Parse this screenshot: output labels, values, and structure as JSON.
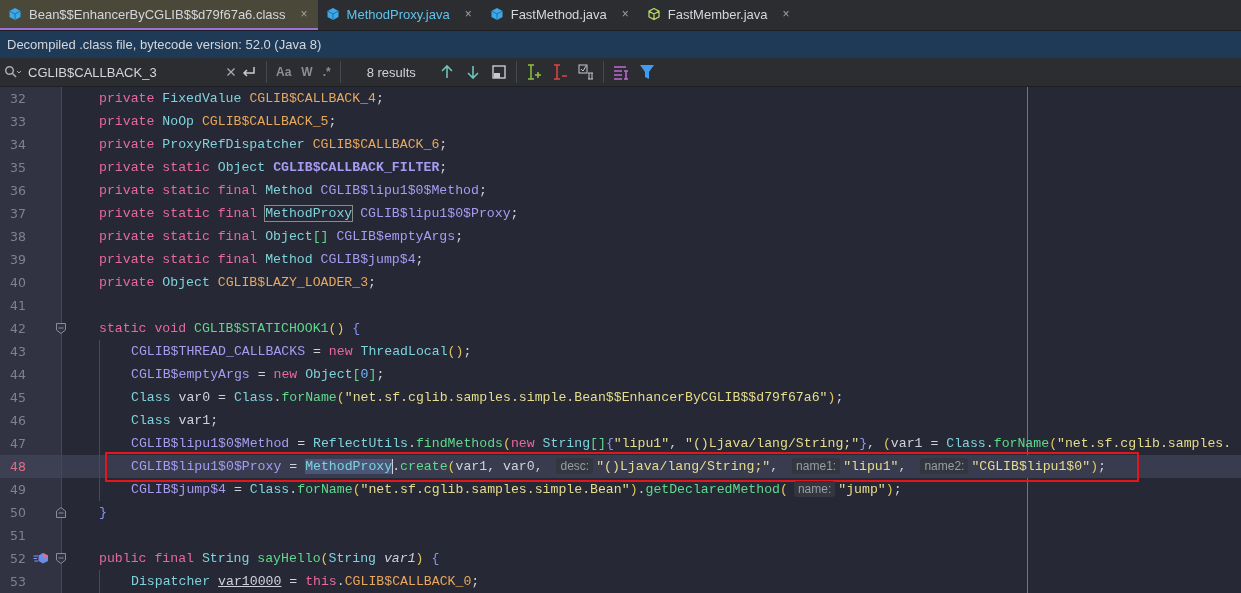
{
  "tabs": [
    {
      "label": "Bean$$EnhancerByCGLIB$$d79f67a6.class",
      "close": "×",
      "kind": "class",
      "selected": true,
      "modified": false
    },
    {
      "label": "MethodProxy.java",
      "close": "×",
      "kind": "java",
      "selected": false,
      "modified": true
    },
    {
      "label": "FastMethod.java",
      "close": "×",
      "kind": "java",
      "selected": false,
      "modified": false
    },
    {
      "label": "FastMember.java",
      "close": "×",
      "kind": "member",
      "selected": false,
      "modified": false
    }
  ],
  "info_bar": "Decompiled .class file, bytecode version: 52.0 (Java 8)",
  "search": {
    "value": "CGLIB$CALLBACK_3",
    "options": [
      "Aa",
      "W",
      ".*"
    ],
    "results": "8 results"
  },
  "lines": [
    {
      "number": "32",
      "tokens": [
        {
          "t": "private ",
          "kind": "kw"
        },
        {
          "t": "FixedValue ",
          "kind": "type"
        },
        {
          "t": "CGLIB$CALLBACK_4",
          "kind": "field"
        },
        {
          "t": ";",
          "kind": "plain"
        }
      ]
    },
    {
      "number": "33",
      "tokens": [
        {
          "t": "private ",
          "kind": "kw"
        },
        {
          "t": "NoOp ",
          "kind": "type"
        },
        {
          "t": "CGLIB$CALLBACK_5",
          "kind": "field"
        },
        {
          "t": ";",
          "kind": "plain"
        }
      ]
    },
    {
      "number": "34",
      "tokens": [
        {
          "t": "private ",
          "kind": "kw"
        },
        {
          "t": "ProxyRefDispatcher ",
          "kind": "type"
        },
        {
          "t": "CGLIB$CALLBACK_6",
          "kind": "field"
        },
        {
          "t": ";",
          "kind": "plain"
        }
      ]
    },
    {
      "number": "35",
      "tokens": [
        {
          "t": "private static ",
          "kind": "kw"
        },
        {
          "t": "Object ",
          "kind": "type"
        },
        {
          "t": "CGLIB$CALLBACK_FILTER",
          "kind": "sfieldb"
        },
        {
          "t": ";",
          "kind": "plain"
        }
      ]
    },
    {
      "number": "36",
      "tokens": [
        {
          "t": "private static final ",
          "kind": "kw"
        },
        {
          "t": "Method ",
          "kind": "type"
        },
        {
          "t": "CGLIB$lipu1$0$Method",
          "kind": "sfield"
        },
        {
          "t": ";",
          "kind": "plain"
        }
      ]
    },
    {
      "number": "37",
      "tokens": [
        {
          "t": "private static final ",
          "kind": "kw"
        },
        {
          "t": "MethodProxy",
          "kind": "type",
          "outlined": true
        },
        {
          "t": " CGLIB$lipu1$0$Proxy",
          "kind": "sfield"
        },
        {
          "t": ";",
          "kind": "plain"
        }
      ]
    },
    {
      "number": "38",
      "tokens": [
        {
          "t": "private static final ",
          "kind": "kw"
        },
        {
          "t": "Object",
          "kind": "type"
        },
        {
          "t": "[]",
          "kind": "bracket"
        },
        {
          "t": " CGLIB$emptyArgs",
          "kind": "sfield"
        },
        {
          "t": ";",
          "kind": "plain"
        }
      ]
    },
    {
      "number": "39",
      "tokens": [
        {
          "t": "private static final ",
          "kind": "kw"
        },
        {
          "t": "Method ",
          "kind": "type"
        },
        {
          "t": "CGLIB$jump$4",
          "kind": "sfield"
        },
        {
          "t": ";",
          "kind": "plain"
        }
      ]
    },
    {
      "number": "40",
      "tokens": [
        {
          "t": "private ",
          "kind": "kw"
        },
        {
          "t": "Object ",
          "kind": "type"
        },
        {
          "t": "CGLIB$LAZY_LOADER_3",
          "kind": "field"
        },
        {
          "t": ";",
          "kind": "plain"
        }
      ]
    },
    {
      "number": "41"
    },
    {
      "number": "42",
      "fold_start": true,
      "tokens": [
        {
          "t": "static void ",
          "kind": "kw"
        },
        {
          "t": "CGLIB$STATICHOOK1",
          "kind": "method"
        },
        {
          "t": "()",
          "kind": "paren"
        },
        {
          "t": " {",
          "kind": "brace"
        }
      ],
      "children": [
        {
          "number": "43",
          "tokens": [
            {
              "t": "CGLIB$THREAD_CALLBACKS",
              "kind": "sfield"
            },
            {
              "t": " = ",
              "kind": "plain"
            },
            {
              "t": "new ",
              "kind": "kw"
            },
            {
              "t": "ThreadLocal",
              "kind": "type"
            },
            {
              "t": "()",
              "kind": "paren"
            },
            {
              "t": ";",
              "kind": "plain"
            }
          ]
        },
        {
          "number": "44",
          "tokens": [
            {
              "t": "CGLIB$emptyArgs",
              "kind": "sfield"
            },
            {
              "t": " = ",
              "kind": "plain"
            },
            {
              "t": "new ",
              "kind": "kw"
            },
            {
              "t": "Object",
              "kind": "type"
            },
            {
              "t": "[",
              "kind": "bracket"
            },
            {
              "t": "0",
              "kind": "num"
            },
            {
              "t": "]",
              "kind": "bracket"
            },
            {
              "t": ";",
              "kind": "plain"
            }
          ]
        },
        {
          "number": "45",
          "tokens": [
            {
              "t": "Class ",
              "kind": "type"
            },
            {
              "t": "var0 = ",
              "kind": "plain"
            },
            {
              "t": "Class",
              "kind": "type"
            },
            {
              "t": ".",
              "kind": "plain"
            },
            {
              "t": "forName",
              "kind": "method"
            },
            {
              "t": "(",
              "kind": "paren"
            },
            {
              "t": "\"net.sf.cglib.samples.simple.Bean$$EnhancerByCGLIB$$d79f67a6\"",
              "kind": "str"
            },
            {
              "t": ")",
              "kind": "paren"
            },
            {
              "t": ";",
              "kind": "plain"
            }
          ]
        },
        {
          "number": "46",
          "tokens": [
            {
              "t": "Class ",
              "kind": "type"
            },
            {
              "t": "var1;",
              "kind": "plain"
            }
          ]
        },
        {
          "number": "47",
          "tokens": [
            {
              "t": "CGLIB$lipu1$0$Method",
              "kind": "sfield"
            },
            {
              "t": " = ",
              "kind": "plain"
            },
            {
              "t": "ReflectUtils",
              "kind": "type"
            },
            {
              "t": ".",
              "kind": "plain"
            },
            {
              "t": "findMethods",
              "kind": "method"
            },
            {
              "t": "(",
              "kind": "paren"
            },
            {
              "t": "new ",
              "kind": "kw"
            },
            {
              "t": "String",
              "kind": "type"
            },
            {
              "t": "[]",
              "kind": "bracket"
            },
            {
              "t": "{",
              "kind": "brace"
            },
            {
              "t": "\"lipu1\"",
              "kind": "str"
            },
            {
              "t": ", ",
              "kind": "plain"
            },
            {
              "t": "\"()Ljava/lang/String;\"",
              "kind": "str"
            },
            {
              "t": "}",
              "kind": "brace"
            },
            {
              "t": ", ",
              "kind": "plain"
            },
            {
              "t": "(",
              "kind": "paren"
            },
            {
              "t": "var1 = ",
              "kind": "plain"
            },
            {
              "t": "Class",
              "kind": "type"
            },
            {
              "t": ".",
              "kind": "plain"
            },
            {
              "t": "forName",
              "kind": "method"
            },
            {
              "t": "(",
              "kind": "paren"
            },
            {
              "t": "\"net.sf.cglib.samples.",
              "kind": "str"
            }
          ]
        },
        {
          "number": "48",
          "current": true,
          "annotated": true,
          "tokens": [
            {
              "t": "CGLIB$lipu1$0$Proxy",
              "kind": "sfield"
            },
            {
              "t": " = ",
              "kind": "plain"
            },
            {
              "t": "MethodProxy",
              "kind": "type",
              "text_selected": true
            },
            {
              "t": ".",
              "kind": "plain"
            },
            {
              "t": "create",
              "kind": "method"
            },
            {
              "t": "(",
              "kind": "paren"
            },
            {
              "t": "var1, var0, ",
              "kind": "plain"
            },
            {
              "t": "desc:",
              "kind": "hint"
            },
            {
              "t": "\"()Ljava/lang/String;\"",
              "kind": "str"
            },
            {
              "t": ", ",
              "kind": "plain"
            },
            {
              "t": "name1:",
              "kind": "hint"
            },
            {
              "t": "\"lipu1\"",
              "kind": "str"
            },
            {
              "t": ", ",
              "kind": "plain"
            },
            {
              "t": "name2:",
              "kind": "hint"
            },
            {
              "t": "\"CGLIB$lipu1$0\"",
              "kind": "str"
            },
            {
              "t": ")",
              "kind": "paren"
            },
            {
              "t": ";",
              "kind": "plain"
            }
          ]
        },
        {
          "number": "49",
          "tokens": [
            {
              "t": "CGLIB$jump$4",
              "kind": "sfield"
            },
            {
              "t": " = ",
              "kind": "plain"
            },
            {
              "t": "Class",
              "kind": "type"
            },
            {
              "t": ".",
              "kind": "plain"
            },
            {
              "t": "forName",
              "kind": "method"
            },
            {
              "t": "(",
              "kind": "paren"
            },
            {
              "t": "\"net.sf.cglib.samples.simple.Bean\"",
              "kind": "str"
            },
            {
              "t": ")",
              "kind": "paren"
            },
            {
              "t": ".",
              "kind": "plain"
            },
            {
              "t": "getDeclaredMethod",
              "kind": "method"
            },
            {
              "t": "(",
              "kind": "paren"
            },
            {
              "t": "name:",
              "kind": "hint"
            },
            {
              "t": "\"jump\"",
              "kind": "str"
            },
            {
              "t": ")",
              "kind": "paren"
            },
            {
              "t": ";",
              "kind": "plain"
            }
          ]
        }
      ]
    },
    {
      "number": "50",
      "fold_end": true,
      "tokens": [
        {
          "t": "}",
          "kind": "brace"
        }
      ]
    },
    {
      "number": "51"
    },
    {
      "number": "52",
      "fold_start": true,
      "implemented": true,
      "tokens": [
        {
          "t": "public final ",
          "kind": "kw"
        },
        {
          "t": "String ",
          "kind": "type"
        },
        {
          "t": "sayHello",
          "kind": "method"
        },
        {
          "t": "(",
          "kind": "paren"
        },
        {
          "t": "String ",
          "kind": "type"
        },
        {
          "t": "var1",
          "kind": "param"
        },
        {
          "t": ")",
          "kind": "paren"
        },
        {
          "t": " {",
          "kind": "brace"
        }
      ],
      "children": [
        {
          "number": "53",
          "tokens": [
            {
              "t": "Dispatcher ",
              "kind": "type"
            },
            {
              "t": "var10000",
              "kind": "underline"
            },
            {
              "t": " = ",
              "kind": "plain"
            },
            {
              "t": "this",
              "kind": "kw"
            },
            {
              "t": ".",
              "kind": "plain"
            },
            {
              "t": "CGLIB$CALLBACK_0",
              "kind": "field"
            },
            {
              "t": ";",
              "kind": "plain"
            }
          ]
        }
      ]
    }
  ]
}
